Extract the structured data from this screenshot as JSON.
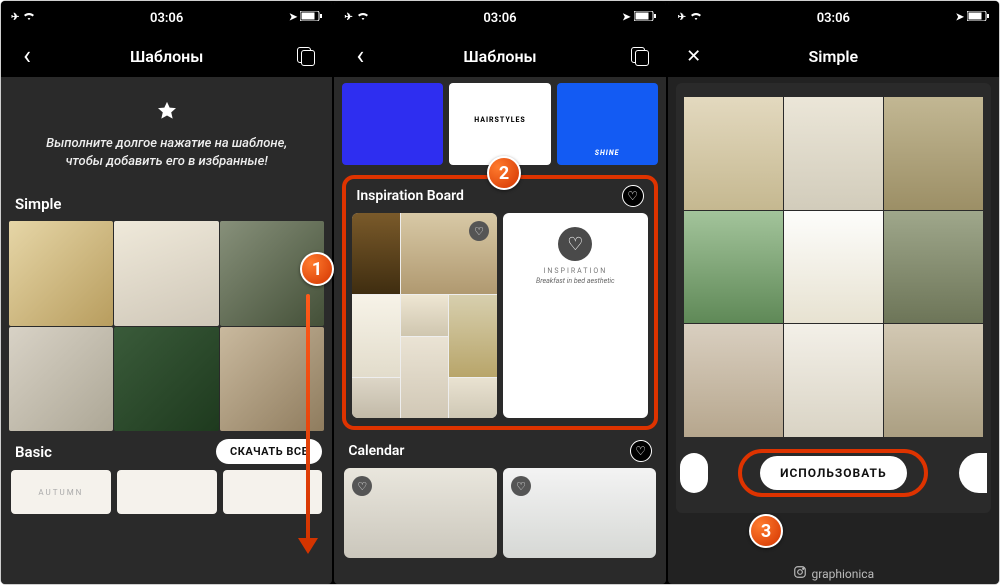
{
  "status": {
    "time": "03:06"
  },
  "screen1": {
    "nav_title": "Шаблоны",
    "tip": "Выполните долгое нажатие на шаблоне, чтобы добавить его в избранные!",
    "section_simple": "Simple",
    "section_basic": "Basic",
    "download_all": "СКАЧАТЬ ВСЕ",
    "basic_thumb_label": "AUTUMN"
  },
  "screen2": {
    "nav_title": "Шаблоны",
    "top_hairstyles": "HAIRSTYLES",
    "top_shine": "SHINE",
    "section_inspiration": "Inspiration Board",
    "insp_label": "INSPIRATION",
    "insp_sub": "Breakfast in bed aesthetic",
    "section_calendar": "Calendar"
  },
  "screen3": {
    "nav_title": "Simple",
    "use_btn": "ИСПОЛЬЗОВАТЬ",
    "brand": "graphionica"
  },
  "badges": {
    "b1": "1",
    "b2": "2",
    "b3": "3"
  }
}
